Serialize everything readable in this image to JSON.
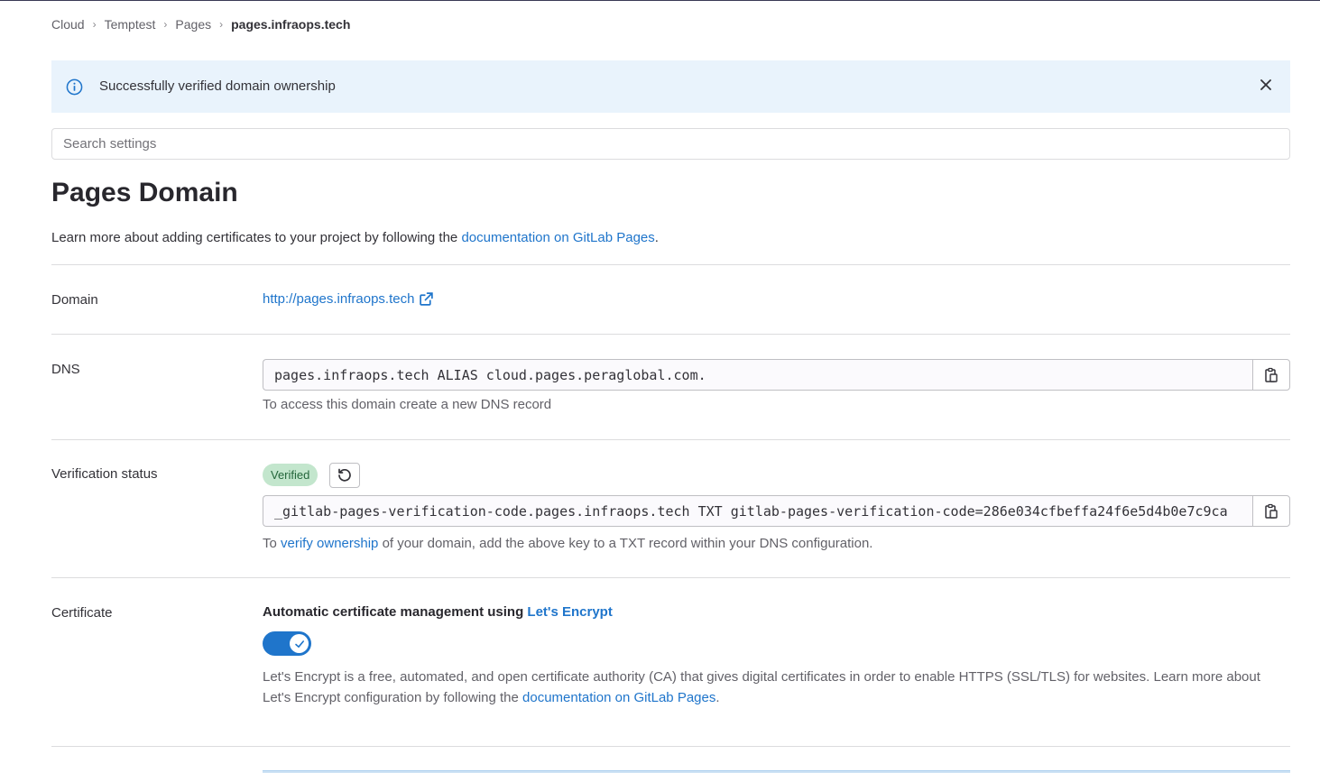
{
  "breadcrumb": {
    "items": [
      "Cloud",
      "Temptest",
      "Pages"
    ],
    "current": "pages.infraops.tech"
  },
  "alert": {
    "message": "Successfully verified domain ownership",
    "icon": "info-icon",
    "close_icon": "close-icon"
  },
  "search": {
    "placeholder": "Search settings"
  },
  "page": {
    "title": "Pages Domain",
    "intro_prefix": "Learn more about adding certificates to your project by following the ",
    "intro_link": "documentation on GitLab Pages",
    "intro_suffix": "."
  },
  "domain": {
    "label": "Domain",
    "url": "http://pages.infraops.tech",
    "icon": "external-link-icon"
  },
  "dns": {
    "label": "DNS",
    "record": "pages.infraops.tech ALIAS cloud.pages.peraglobal.com.",
    "help": "To access this domain create a new DNS record",
    "copy_icon": "copy-icon"
  },
  "verification": {
    "label": "Verification status",
    "badge": "Verified",
    "retry_icon": "retry-icon",
    "record": "_gitlab-pages-verification-code.pages.infraops.tech TXT gitlab-pages-verification-code=286e034cfbeffa24f6e5d4b0e7c9ca",
    "help_prefix": "To ",
    "help_link": "verify ownership",
    "help_suffix": " of your domain, add the above key to a TXT record within your DNS configuration."
  },
  "certificate": {
    "label": "Certificate",
    "title_prefix": "Automatic certificate management using ",
    "title_link": "Let's Encrypt",
    "toggle_on": true,
    "desc_prefix": "Let's Encrypt is a free, automated, and open certificate authority (CA) that gives digital certificates in order to enable HTTPS (SSL/TLS) for websites. Learn more about Let's Encrypt configuration by following the ",
    "desc_link": "documentation on GitLab Pages",
    "desc_suffix": "."
  },
  "colors": {
    "link": "#1f75cb",
    "alert_bg": "#e9f3fc",
    "badge_bg": "#c3e6cd",
    "badge_text": "#24663b"
  }
}
